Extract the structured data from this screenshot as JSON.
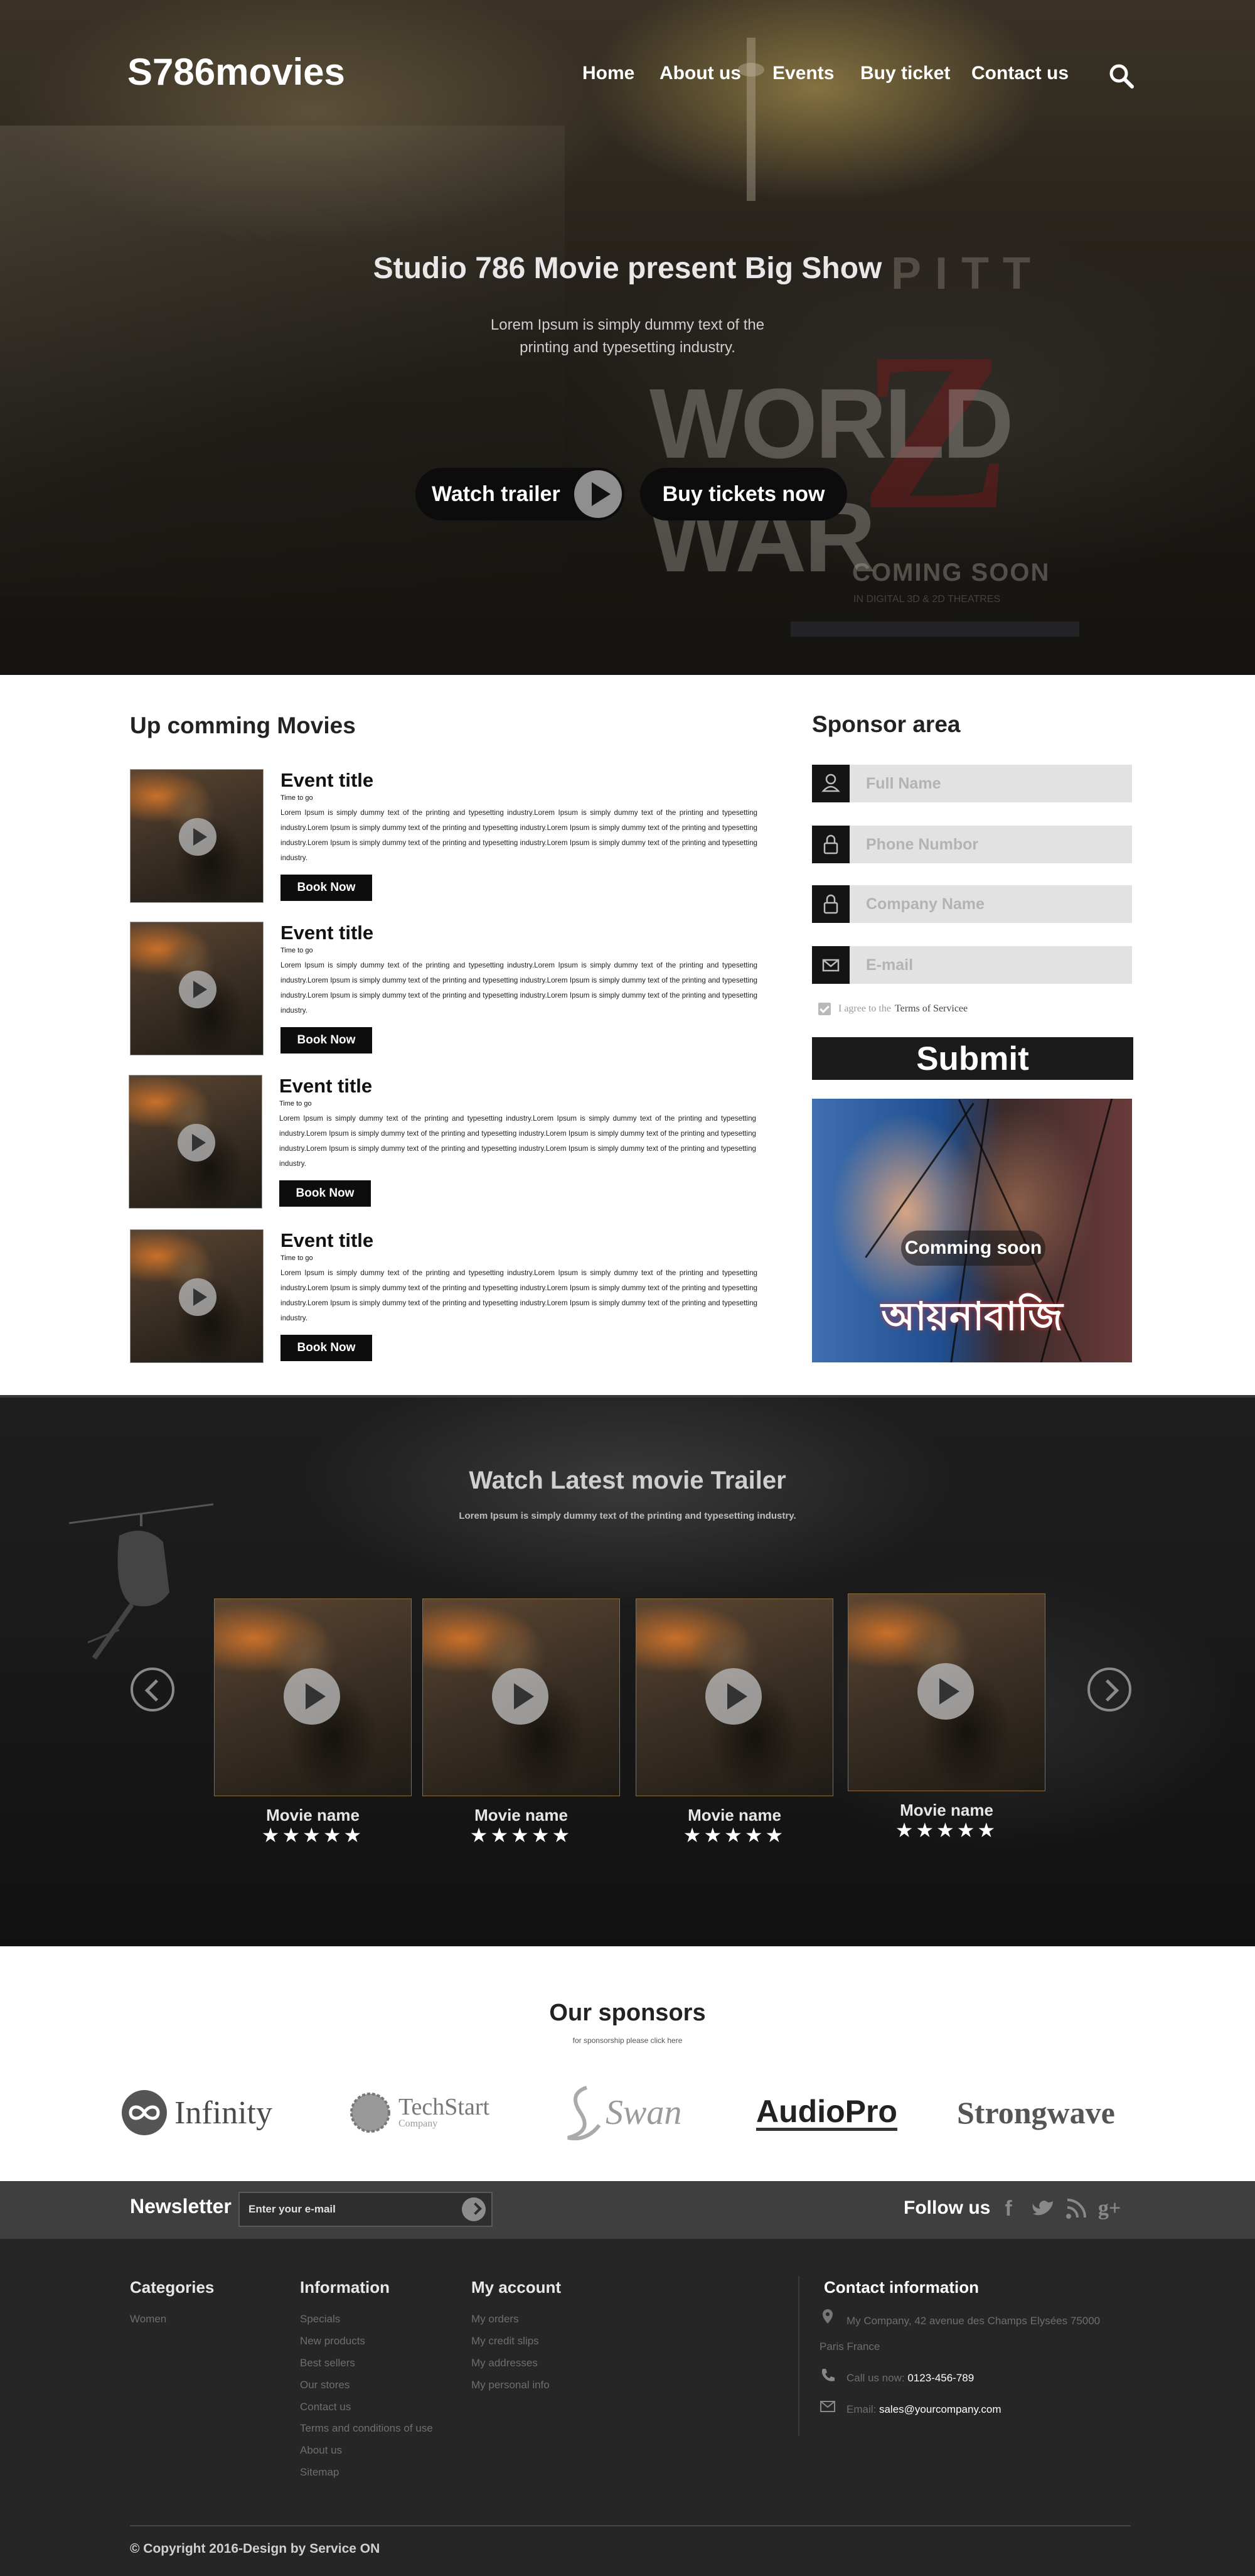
{
  "header": {
    "brand": "S786movies",
    "nav": [
      "Home",
      "About us",
      "Events",
      "Buy ticket",
      "Contact us"
    ]
  },
  "hero": {
    "title": "Studio 786 Movie present Big Show",
    "subtitle": "Lorem Ipsum is simply dummy text of the printing and typesetting industry.",
    "watch_label": "Watch trailer",
    "buy_label": "Buy tickets now",
    "poster": {
      "actor": "PITT",
      "title": "WORLD WAR",
      "letter": "Z",
      "coming": "COMING SOON",
      "small": "IN DIGITAL 3D & 2D THEATRES"
    }
  },
  "upcoming": {
    "title": "Up comming Movies",
    "events": [
      {
        "title": "Event title",
        "time": "Time to go",
        "desc": "Lorem Ipsum is simply dummy text of the printing and typesetting industry.Lorem Ipsum is simply dummy text of the printing and typesetting industry.Lorem Ipsum is simply dummy text of the printing and typesetting industry.Lorem Ipsum is simply dummy text of the printing and typesetting industry.Lorem Ipsum is simply dummy text of the printing and typesetting industry.Lorem Ipsum is simply dummy text of the printing and typesetting industry.",
        "button": "Book Now"
      },
      {
        "title": "Event title",
        "time": "Time to go",
        "desc": "Lorem Ipsum is simply dummy text of the printing and typesetting industry.Lorem Ipsum is simply dummy text of the printing and typesetting industry.Lorem Ipsum is simply dummy text of the printing and typesetting industry.Lorem Ipsum is simply dummy text of the printing and typesetting industry.Lorem Ipsum is simply dummy text of the printing and typesetting industry.Lorem Ipsum is simply dummy text of the printing and typesetting industry.",
        "button": "Book Now"
      },
      {
        "title": "Event title",
        "time": "Time to go",
        "desc": "Lorem Ipsum is simply dummy text of the printing and typesetting industry.Lorem Ipsum is simply dummy text of the printing and typesetting industry.Lorem Ipsum is simply dummy text of the printing and typesetting industry.Lorem Ipsum is simply dummy text of the printing and typesetting industry.Lorem Ipsum is simply dummy text of the printing and typesetting industry.Lorem Ipsum is simply dummy text of the printing and typesetting industry.",
        "button": "Book Now"
      },
      {
        "title": "Event title",
        "time": "Time to go",
        "desc": "Lorem Ipsum is simply dummy text of the printing and typesetting industry.Lorem Ipsum is simply dummy text of the printing and typesetting industry.Lorem Ipsum is simply dummy text of the printing and typesetting industry.Lorem Ipsum is simply dummy text of the printing and typesetting industry.Lorem Ipsum is simply dummy text of the printing and typesetting industry.Lorem Ipsum is simply dummy text of the printing and typesetting industry.",
        "button": "Book Now"
      }
    ]
  },
  "sponsor_area": {
    "title": "Sponsor area",
    "fields": [
      {
        "placeholder": "Full Name",
        "icon": "user-icon"
      },
      {
        "placeholder": "Phone Numbor",
        "icon": "lock-icon"
      },
      {
        "placeholder": "Company Name",
        "icon": "lock-icon"
      },
      {
        "placeholder": "E-mail",
        "icon": "mail-icon"
      }
    ],
    "agree_prefix": "I agree to the",
    "agree_link": "Terms of Servicee",
    "submit": "Submit",
    "promo_label": "Comming soon",
    "promo_title": "আয়নাবাজি"
  },
  "trailers": {
    "title": "Watch Latest movie Trailer",
    "subtitle": "Lorem Ipsum is simply dummy text of the printing and typesetting industry.",
    "cards": [
      {
        "name": "Movie name",
        "stars": "★★★★★"
      },
      {
        "name": "Movie name",
        "stars": "★★★★★"
      },
      {
        "name": "Movie name",
        "stars": "★★★★★"
      },
      {
        "name": "Movie name",
        "stars": "★★★★★"
      }
    ]
  },
  "sponsors": {
    "title": "Our sponsors",
    "subtitle": "for sponsorship please click here",
    "logos": [
      "Infinity",
      "TechStart",
      "Company",
      "Swan",
      "AudioPro",
      "Strongwave"
    ]
  },
  "newsletter": {
    "label": "Newsletter",
    "placeholder": "Enter your e-mail",
    "follow": "Follow us"
  },
  "footer": {
    "categories": {
      "title": "Categories",
      "items": [
        "Women"
      ]
    },
    "information": {
      "title": "Information",
      "items": [
        "Specials",
        "New products",
        "Best sellers",
        "Our stores",
        "Contact us",
        "Terms and conditions of use",
        "About us",
        "Sitemap"
      ]
    },
    "account": {
      "title": "My account",
      "items": [
        "My orders",
        "My credit slips",
        "My addresses",
        "My personal info"
      ]
    },
    "contact": {
      "title": "Contact information",
      "address_line1": "My Company, 42 avenue des Champs Elysées 75000",
      "address_line2": "Paris France",
      "call_label": "Call us now:",
      "phone": "0123-456-789",
      "email_label": "Email:",
      "email": "sales@yourcompany.com"
    },
    "copyright": "© Copyright 2016-Design by Service ON"
  }
}
